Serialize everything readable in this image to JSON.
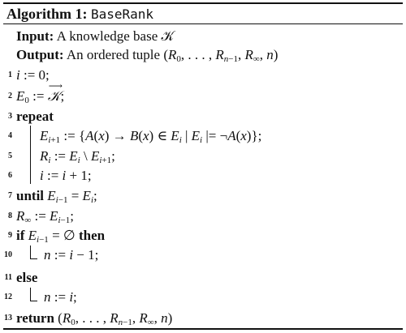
{
  "caption": {
    "label": "Algorithm 1:",
    "name": "BaseRank"
  },
  "input": {
    "label": "Input:",
    "text": "A knowledge base 𝒦"
  },
  "output": {
    "label": "Output:",
    "text_prefix": "An ordered tuple (R",
    "text": "(R0, . . . , Rn−1, R∞, n)"
  },
  "lines": [
    {
      "num": "1",
      "text": "i := 0;"
    },
    {
      "num": "2",
      "text": "E0 := 𝒦;"
    },
    {
      "num": "3",
      "keyword": "repeat"
    },
    {
      "num": "4",
      "text": "Ei+1 := {A(x) → B(x) ∈ Ei | Ei |= ¬A(x)};"
    },
    {
      "num": "5",
      "text": "Ri := Ei \\ Ei+1;"
    },
    {
      "num": "6",
      "text": "i := i + 1;"
    },
    {
      "num": "7",
      "keyword": "until",
      "text": "Ei−1 = Ei;"
    },
    {
      "num": "8",
      "text": "R∞ := Ei−1;"
    },
    {
      "num": "9",
      "keyword": "if",
      "text": "Ei−1 = ∅",
      "keyword2": "then"
    },
    {
      "num": "10",
      "text": "n := i − 1;"
    },
    {
      "num": "11",
      "keyword": "else"
    },
    {
      "num": "12",
      "text": "n := i;"
    },
    {
      "num": "13",
      "keyword": "return",
      "text": "(R0, . . . , Rn−1, R∞, n)"
    }
  ]
}
